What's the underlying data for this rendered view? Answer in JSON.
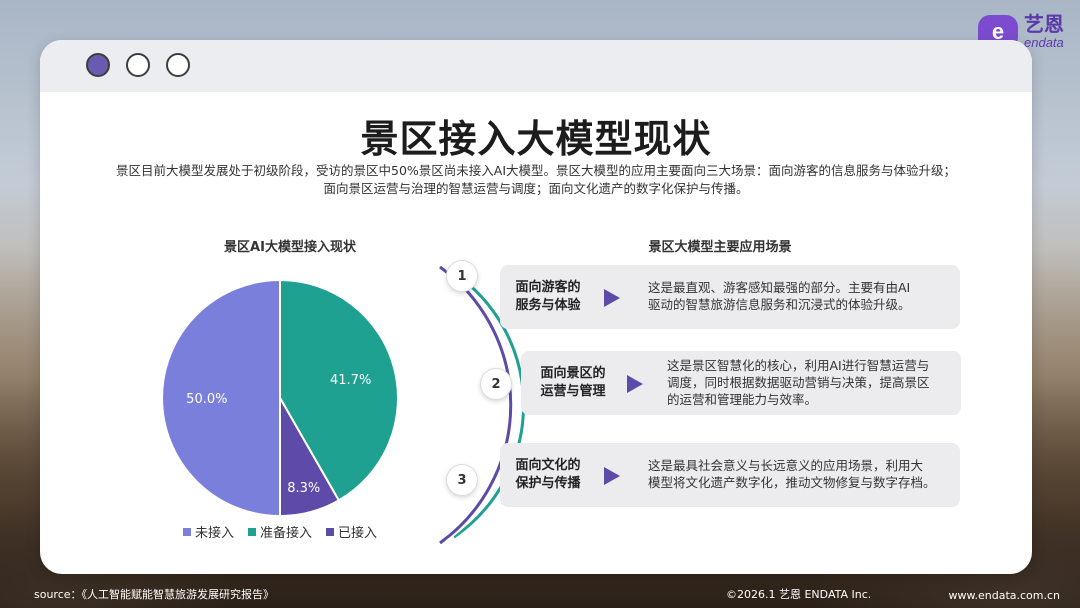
{
  "brand": {
    "icon_letter": "e",
    "name_cn": "艺恩",
    "name_en": "endata"
  },
  "page": {
    "title": "景区接入大模型现状",
    "description_line1": "景区目前大模型发展处于初级阶段，受访的景区中50%景区尚未接入AI大模型。景区大模型的应用主要面向三大场景：面向游客的信息服务与体验升级；",
    "description_line2": "面向景区运营与治理的智慧运营与调度；面向文化遗产的数字化保护与传播。"
  },
  "chart_data": {
    "type": "pie",
    "title": "景区AI大模型接入现状",
    "categories": [
      "未接入",
      "准备接入",
      "已接入"
    ],
    "values": [
      50.0,
      41.7,
      8.3
    ],
    "value_labels": [
      "50.0%",
      "41.7%",
      "8.3%"
    ],
    "colors": [
      "#7b7fdc",
      "#1fa192",
      "#5e4aa8"
    ],
    "legend_position": "bottom"
  },
  "scenarios": {
    "title": "景区大模型主要应用场景",
    "items": [
      {
        "number": "1",
        "label_line1": "面向游客的",
        "label_line2": "服务与体验",
        "text_line1": "这是最直观、游客感知最强的部分。主要有由AI",
        "text_line2": "驱动的智慧旅游信息服务和沉浸式的体验升级。",
        "text_line3": ""
      },
      {
        "number": "2",
        "label_line1": "面向景区的",
        "label_line2": "运营与管理",
        "text_line1": "这是景区智慧化的核心，利用AI进行智慧运营与",
        "text_line2": "调度，同时根据数据驱动营销与决策，提高景区",
        "text_line3": "的运营和管理能力与效率。"
      },
      {
        "number": "3",
        "label_line1": "面向文化的",
        "label_line2": "保护与传播",
        "text_line1": "这是最具社会意义与长远意义的应用场景，利用大",
        "text_line2": "模型将文化遗产数字化，推动文物修复与数字存档。",
        "text_line3": ""
      }
    ],
    "arc_colors": [
      "#5e4aa8",
      "#1fa192"
    ]
  },
  "footer": {
    "source": "source：《人工智能赋能智慧旅游发展研究报告》",
    "copyright": "©2026.1  艺恩 ENDATA Inc.",
    "website": "www.endata.com.cn"
  }
}
